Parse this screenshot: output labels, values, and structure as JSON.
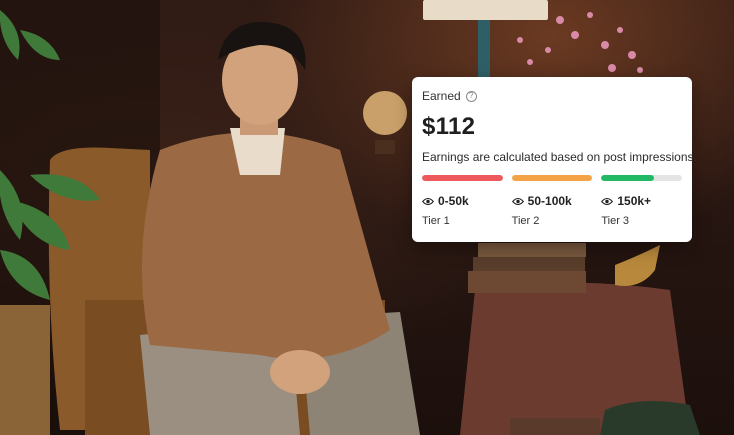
{
  "card": {
    "label": "Earned",
    "help_icon": "question-circle-icon",
    "amount": "$112",
    "description": "Earnings are calculated based on post impressions.",
    "tiers": [
      {
        "range": "0-50k",
        "name": "Tier 1",
        "color": "#ee5a5c",
        "fill": 1.0,
        "icon": "eye-icon"
      },
      {
        "range": "50-100k",
        "name": "Tier 2",
        "color": "#f4a446",
        "fill": 1.0,
        "icon": "eye-icon"
      },
      {
        "range": "150k+",
        "name": "Tier 3",
        "color": "#22b864",
        "fill": 0.65,
        "icon": "eye-icon"
      }
    ]
  }
}
